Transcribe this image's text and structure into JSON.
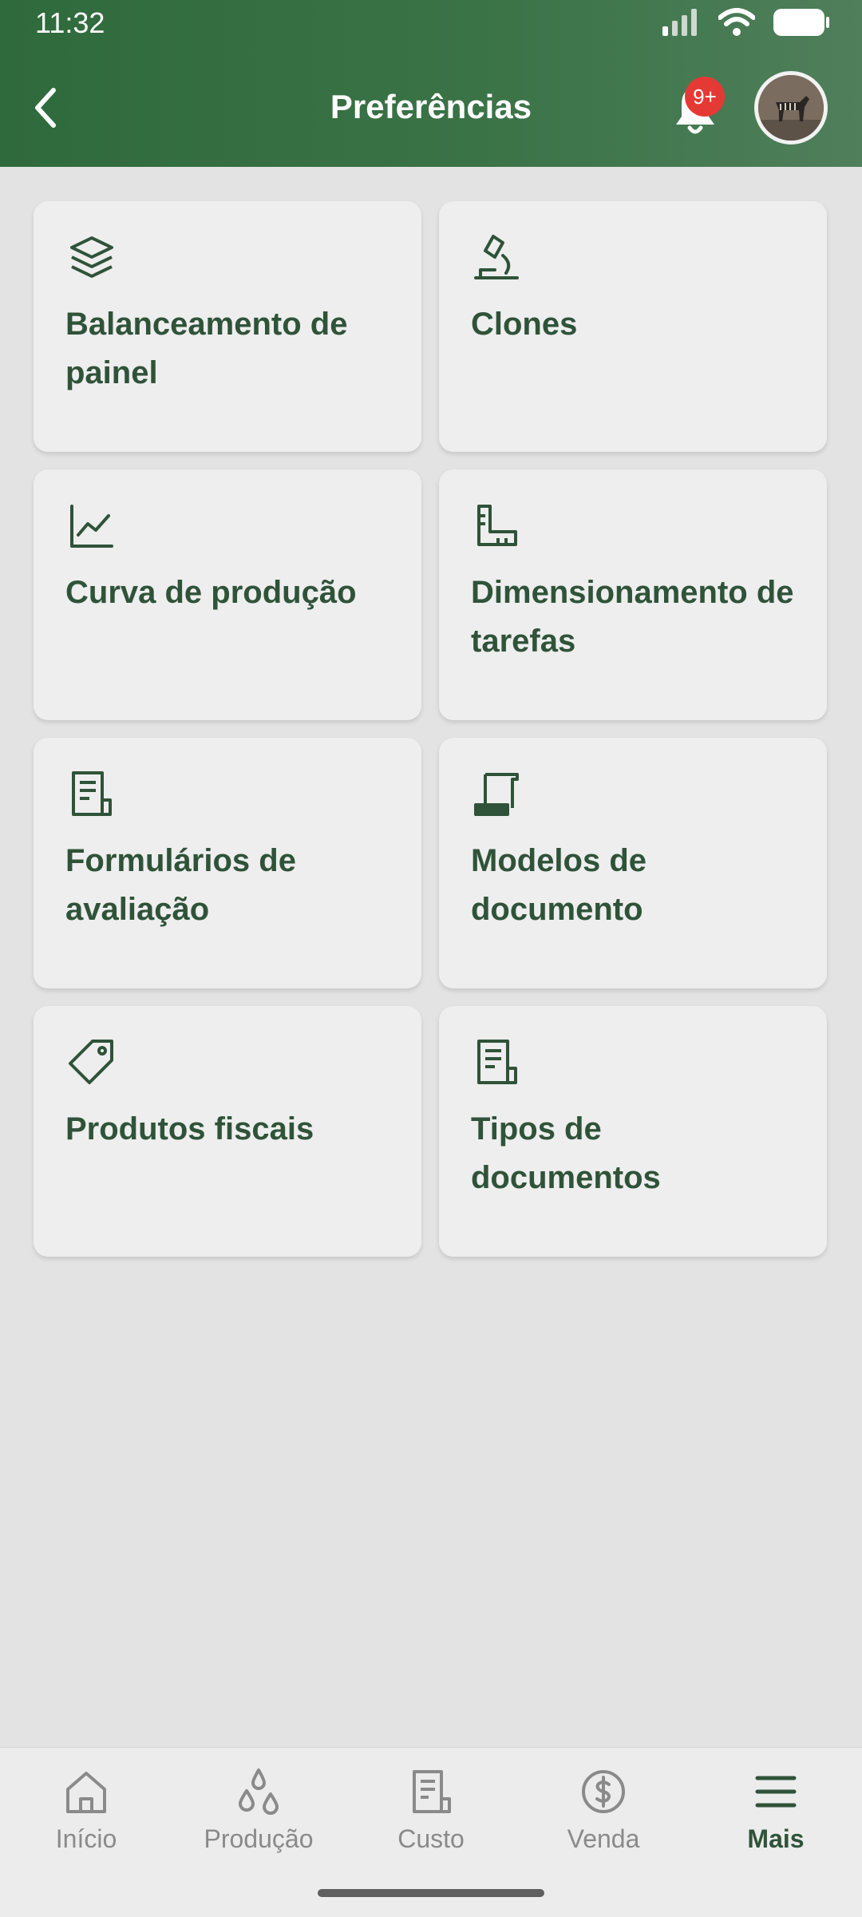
{
  "status_bar": {
    "time": "11:32"
  },
  "header": {
    "title": "Preferências",
    "notification_badge": "9+"
  },
  "cards": [
    {
      "label": "Balanceamento de painel",
      "icon": "layers-icon"
    },
    {
      "label": "Clones",
      "icon": "microscope-icon"
    },
    {
      "label": "Curva de produção",
      "icon": "line-chart-icon"
    },
    {
      "label": "Dimensionamento de tarefas",
      "icon": "ruler-icon"
    },
    {
      "label": "Formulários de avaliação",
      "icon": "form-document-icon"
    },
    {
      "label": "Modelos de documento",
      "icon": "scroll-icon"
    },
    {
      "label": "Produtos fiscais",
      "icon": "tag-icon"
    },
    {
      "label": "Tipos de documentos",
      "icon": "document-list-icon"
    }
  ],
  "bottom_nav": {
    "items": [
      {
        "label": "Início",
        "icon": "home-icon"
      },
      {
        "label": "Produção",
        "icon": "drops-icon"
      },
      {
        "label": "Custo",
        "icon": "receipt-icon"
      },
      {
        "label": "Venda",
        "icon": "dollar-coin-icon"
      },
      {
        "label": "Mais",
        "icon": "menu-icon",
        "active": true
      }
    ]
  },
  "colors": {
    "header_green": "#3a7346",
    "text_green": "#2f5339",
    "badge_red": "#e53935",
    "background": "#e3e3e3"
  }
}
